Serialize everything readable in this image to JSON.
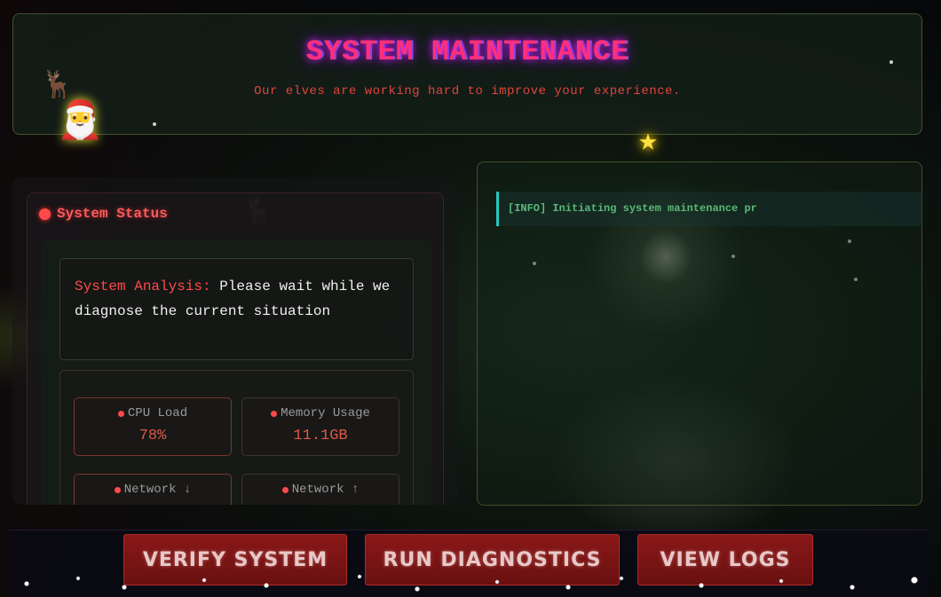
{
  "header": {
    "title": "SYSTEM MAINTENANCE",
    "subtitle": "Our elves are working hard to improve your experience."
  },
  "decorations": {
    "santa_icon": "santa-icon",
    "star_icon": "star-icon",
    "reindeer_icon": "reindeer-icon"
  },
  "status_panel": {
    "title": "System Status",
    "analysis_label": "System Analysis:",
    "analysis_text": " Please wait while we diagnose the current situation",
    "metrics": [
      {
        "label": "CPU Load",
        "value": "78%"
      },
      {
        "label": "Memory Usage",
        "value": "11.1GB"
      },
      {
        "label": "Network ↓",
        "value": ""
      },
      {
        "label": "Network ↑",
        "value": ""
      }
    ]
  },
  "log_panel": {
    "entries": [
      "[INFO] Initiating system maintenance pr"
    ]
  },
  "footer": {
    "buttons": [
      {
        "label": "VERIFY SYSTEM"
      },
      {
        "label": "RUN DIAGNOSTICS"
      },
      {
        "label": "VIEW LOGS"
      }
    ]
  },
  "colors": {
    "accent_red": "#ff4a4a",
    "title_pink": "#ff2f7a",
    "log_green": "#5ab878",
    "log_border": "#28c8c0",
    "button_bg": "#8a1818"
  }
}
